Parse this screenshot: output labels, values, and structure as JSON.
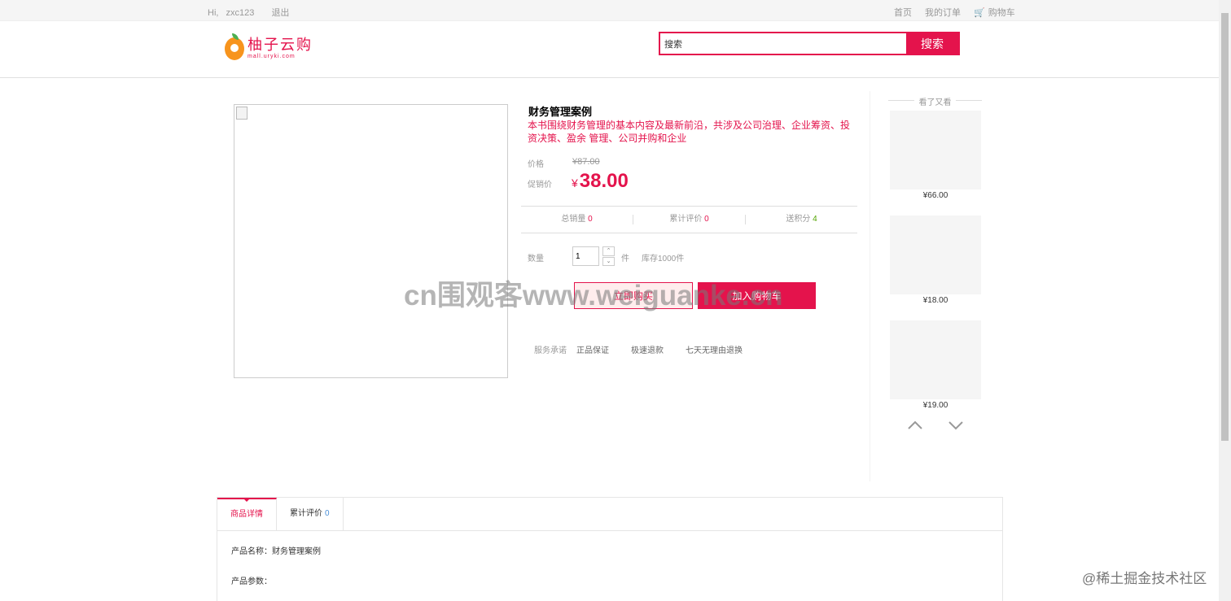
{
  "topbar": {
    "greeting": "Hi,",
    "username": "zxc123",
    "logout": "退出",
    "home": "首页",
    "orders": "我的订单",
    "cart": "购物车"
  },
  "logo": {
    "name": "柚子云购",
    "subtitle": "mall.uryki.com"
  },
  "search": {
    "value": "搜索",
    "button": "搜索"
  },
  "product": {
    "title": "财务管理案例",
    "description": "本书围绕财务管理的基本内容及最新前沿，共涉及公司治理、企业筹资、投资决策、盈余 管理、公司并购和企业",
    "price_label": "价格",
    "old_price": "¥87.00",
    "promo_label": "促销价",
    "currency": "¥",
    "promo_price": "38.00",
    "stats": {
      "sales_label": "总销量",
      "sales": "0",
      "reviews_label": "累计评价",
      "reviews": "0",
      "points_label": "送积分",
      "points": "4"
    },
    "quantity_label": "数量",
    "quantity": "1",
    "unit": "件",
    "stock": "库存1000件",
    "buy_now": "立即购买",
    "add_cart": "加入购物车",
    "service_label": "服务承诺",
    "services": [
      "正品保证",
      "极速退款",
      "七天无理由退换"
    ]
  },
  "recommend": {
    "title": "看了又看",
    "items": [
      {
        "price": "¥66.00"
      },
      {
        "price": "¥18.00"
      },
      {
        "price": "¥19.00"
      }
    ]
  },
  "tabs": {
    "detail": "商品详情",
    "reviews": "累计评价",
    "reviews_count": "0"
  },
  "detail": {
    "name_line": "产品名称：财务管理案例",
    "params_line": "产品参数："
  },
  "watermark": "cn围观客www.weiguanke.cn",
  "footer_mark": "@稀土掘金技术社区",
  "colors": {
    "accent": "#e4134c",
    "link": "#4a8fd8",
    "points": "#52a400"
  }
}
